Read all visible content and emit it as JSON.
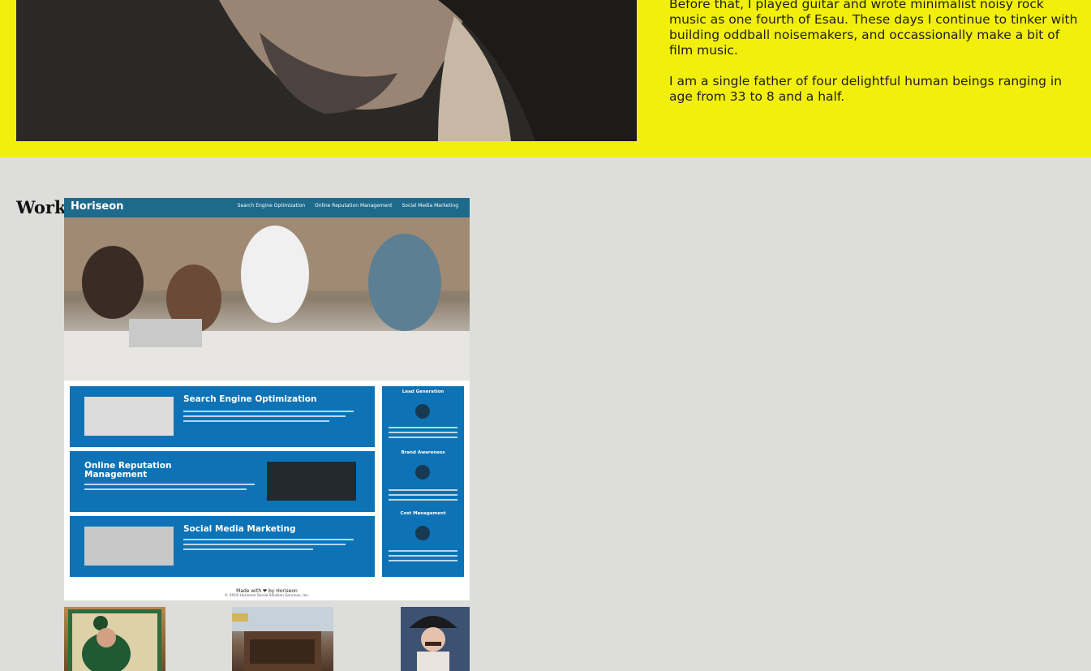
{
  "about": {
    "paragraphs": [
      "Before that, I played guitar and wrote minimalist noisy rock music as one fourth of Esau. These days I continue to tinker with building oddball noisemakers, and occassionally make a bit of film music.",
      "I am a single father of four delightful human beings ranging in age from 33 to 8 and a half."
    ]
  },
  "work": {
    "heading": "Work",
    "project": {
      "brand": "Horiseon",
      "nav": [
        "Search Engine Optimization",
        "Online Reputation Management",
        "Social Media Marketing"
      ],
      "cards": [
        {
          "title": "Search Engine Optimization"
        },
        {
          "title": "Online Reputation Management"
        },
        {
          "title": "Social Media Marketing"
        }
      ],
      "sidebar": [
        "Lead Generation",
        "Brand Awareness",
        "Cost Management"
      ],
      "footer": "Made with ❤ by Horiseon",
      "copyright": "© 2019 Horiseon Social Solution Services, Inc."
    }
  },
  "colors": {
    "about_bg": "#f2ef0c",
    "page_bg": "#dddedb",
    "horiseon_nav": "#1e6a8c",
    "horiseon_card": "#0d73b6"
  }
}
